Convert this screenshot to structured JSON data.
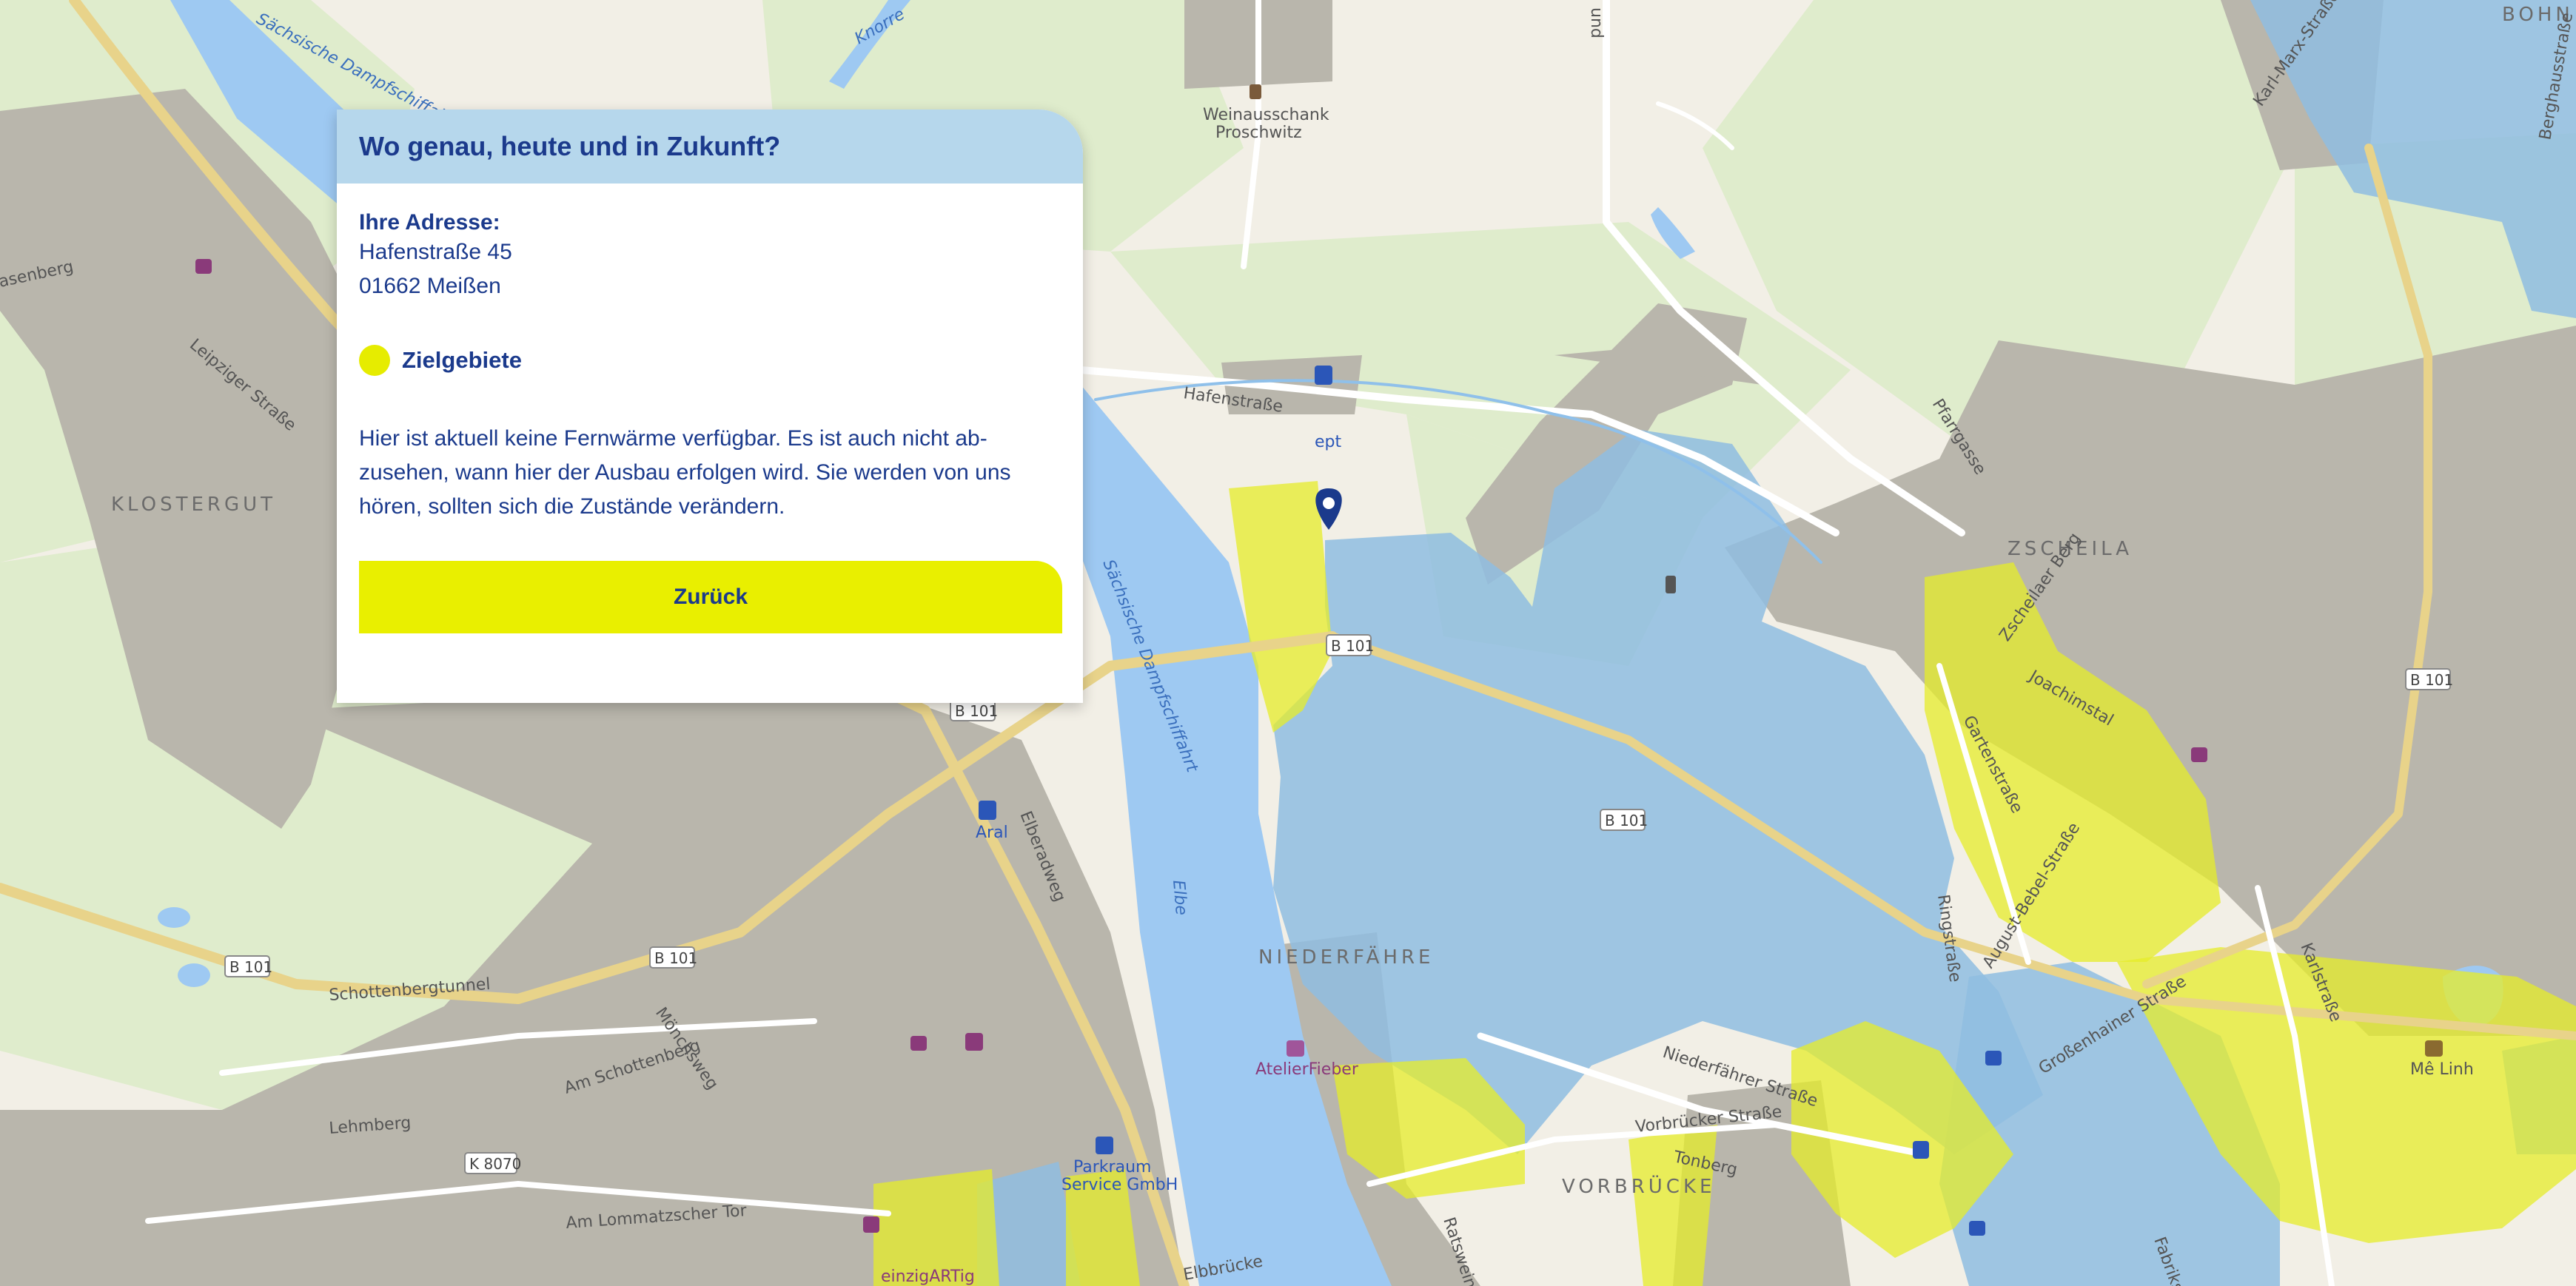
{
  "panel": {
    "title": "Wo genau, heute und in Zukunft?",
    "address_label": "Ihre Adresse:",
    "address_line1": "Hafenstraße 45",
    "address_line2": "01662 Meißen",
    "legend_label": "Zielgebiete",
    "description_lines": [
      "Hier ist aktuell keine Fernwärme verfügbar. Es ist auch nicht ab-",
      "zusehen, wann hier der Ausbau erfolgen wird. Sie werden von uns",
      "hören, sollten sich die Zustände verändern."
    ],
    "button_label": "Zurück"
  },
  "colors": {
    "panel_header": "#b6d7ec",
    "accent_yellow": "#e9ef00",
    "zone_blue": "#8fbde0",
    "text_navy": "#1b3a8c",
    "river": "#9ec9f2"
  },
  "map": {
    "place_labels": {
      "klostergut": "KLOSTERGUT",
      "zscheila": "ZSCHEILA",
      "niederfaehre": "NIEDERFÄHRE",
      "vorbruecke": "VORBRÜCKE",
      "bohn": "BOHN"
    },
    "street_labels": {
      "hafenstrasse": "Hafenstraße",
      "leipziger": "Leipziger Straße",
      "schottenbergtunnel": "Schottenbergtunnel",
      "am_schottenberg": "Am Schottenberg",
      "moenchsweg": "Mönchsweg",
      "lehmberg": "Lehmberg",
      "am_lommatzscher_tor": "Am Lommatzscher Tor",
      "elberadweg": "Elberadweg",
      "pfarrgasse": "Pfarrgasse",
      "zscheilaer": "Zscheilaer Berg",
      "joachimstal": "Joachimstal",
      "gartenstrasse": "Gartenstraße",
      "ringstrasse": "Ringstraße",
      "august_bebel": "August-Bebel-Straße",
      "grossenhainer": "Großenhainer Straße",
      "karlstrasse": "Karlstraße",
      "niederfaehrer": "Niederfährer Straße",
      "vorbruecker": "Vorbrücker Straße",
      "tonberg": "Tonberg",
      "rotsweg": "Ratsweinberg",
      "karl_marx": "Karl-Marx-Straße",
      "berghaus": "Berghausstraße",
      "fabrik": "Fabrikstraße",
      "rasenberg": "asenberg",
      "saechsische": "Sächsische Dampfschiffahrt",
      "saechsische2": "Sächsische Dampfschiffahrt",
      "knorre": "Knorre",
      "elbbruecke": "Elbbrücke",
      "unnamed_top": "und"
    },
    "river_label": "Elbe",
    "poi_labels": {
      "weinausschank1": "Weinausschank",
      "weinausschank2": "Proschwitz",
      "aral": "Aral",
      "ept": "ept",
      "atelier": "AtelierFieber",
      "parkraum1": "Parkraum",
      "parkraum2": "Service GmbH",
      "meilinh": "Mê Linh",
      "einzigartig": "einzigARTig"
    },
    "road_shields": [
      "B 101",
      "B 101",
      "B 101",
      "B 101",
      "B 101",
      "B 101",
      "K 8070"
    ]
  }
}
